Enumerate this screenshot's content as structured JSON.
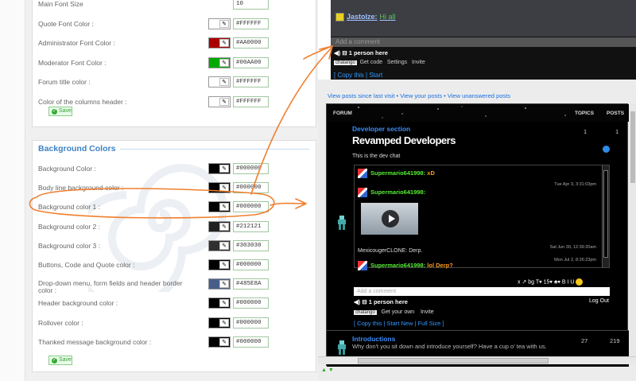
{
  "settings": {
    "rows_top": [
      {
        "label": "Main Font Size",
        "value": "10",
        "color": null
      },
      {
        "label": "Quote Font Color  :",
        "value": "#FFFFFF",
        "color": "#FFFFFF"
      },
      {
        "label": "Administrator Font Color  :",
        "value": "#AA0000",
        "color": "#AA0000"
      },
      {
        "label": "Moderator Font Color  :",
        "value": "#00AA00",
        "color": "#00AA00"
      },
      {
        "label": "Forum title color  :",
        "value": "#FFFFFF",
        "color": "#FFFFFF"
      },
      {
        "label": "Color of the columns header  :",
        "value": "#FFFFFF",
        "color": "#FFFFFF"
      }
    ],
    "save_label": "Save",
    "bg_section_title": "Background Colors",
    "rows_bg": [
      {
        "label": "Background Color  :",
        "value": "#000000",
        "color": "#000000"
      },
      {
        "label": "Body line background color  :",
        "value": "#000000",
        "color": "#000000"
      },
      {
        "label": "Background color 1  :",
        "value": "#000000",
        "color": "#000000"
      },
      {
        "label": "Background color 2  :",
        "value": "#212121",
        "color": "#212121"
      },
      {
        "label": "Background color 3  :",
        "value": "#303030",
        "color": "#303030"
      },
      {
        "label": "Buttons, Code and Quote color  :",
        "value": "#000000",
        "color": "#000000"
      },
      {
        "label": "Drop-down menu, form fields and header border color  :",
        "value": "#485E8A",
        "color": "#485E8A"
      },
      {
        "label": "Header background color  :",
        "value": "#000000",
        "color": "#000000"
      },
      {
        "label": "Rollover color  :",
        "value": "#000000",
        "color": "#000000"
      },
      {
        "label": "Thanked message background color  :",
        "value": "#000000",
        "color": "#000000"
      }
    ],
    "save_label_2": "Save"
  },
  "chat_top": {
    "user": "Jastolze:",
    "message": "Hi all",
    "add_comment": "Add a comment",
    "people": "1 person here",
    "tag": "chatango",
    "get_code": "Get code",
    "settings": "Settings",
    "invite": "Invite",
    "copy_this": "Copy this",
    "start": "Start"
  },
  "forum": {
    "view_links": "View posts since last visit • View your posts • View unanswered posts",
    "col_forum": "FORUM",
    "col_topics": "TOPICS",
    "col_posts": "POSTS",
    "dev_section": "Developer section",
    "revamp_title": "Revamped  Developers",
    "this_chat": "This is the dev chat",
    "dev_topics": "1",
    "dev_posts": "1",
    "chat": {
      "m1_user": "Supermario641998:",
      "m1_text": "xD",
      "m1_time": "Tue Apr 3, 3:31:03pm",
      "m2_user": "Supermario641998:",
      "m3_user": "MexicougerCLONE:",
      "m3_text": "Derp.",
      "m3_time": "Sat Jun 30, 12:39:20am",
      "m4_user": "Supermario641998:",
      "m4_text": "lol Derp?",
      "m4_time": "Mon Jul 2, 8:26:23pm"
    },
    "toolbar": "x  ↗  bg  T▾  15▾  ♣▾  B  I  U",
    "add_comment": "Add a comment",
    "people": "1 person here",
    "logout": "Log Out",
    "tag": "chatango",
    "get_own": "Get your own",
    "invite": "Invite",
    "links": "[ Copy this | Start New | Full Size ]",
    "intro_title": "Introductions",
    "intro_desc": "Why don't you sit down and introduce yourself? Have a cup o' tea with us.",
    "intro_topics": "27",
    "intro_posts": "219"
  },
  "colors": {
    "accent": "#3D82C4",
    "annotation": "#F07F2E"
  }
}
